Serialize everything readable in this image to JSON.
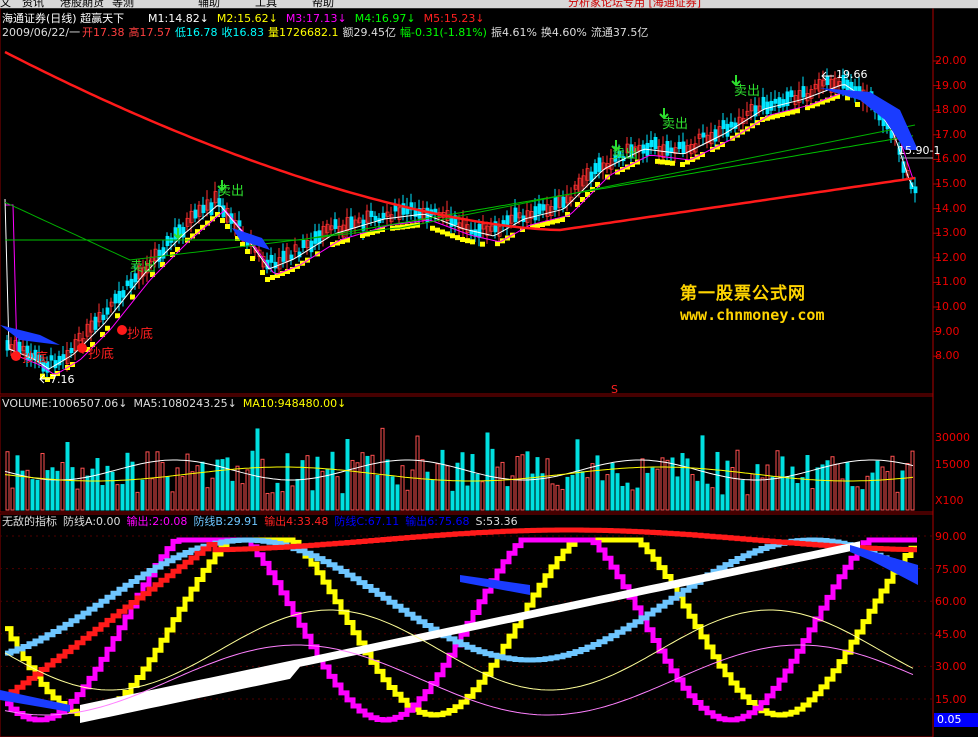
{
  "menu": {
    "items": [
      "文",
      "资讯",
      "港股期货",
      "等测",
      "辅助",
      "工具",
      "帮助"
    ],
    "banner": "分析家论坛专用 [海通证券]"
  },
  "header": {
    "title": "海通证券(日线) 超赢天下",
    "ma": [
      {
        "label": "M1:14.82",
        "color": "#ffffff"
      },
      {
        "label": "M2:15.62",
        "color": "#ffff00"
      },
      {
        "label": "M3:17.13",
        "color": "#ff00ff"
      },
      {
        "label": "M4:16.97",
        "color": "#00ff00"
      },
      {
        "label": "M5:15.23",
        "color": "#ff2020"
      }
    ],
    "quote_date": "2009/06/22/一",
    "quote": [
      {
        "label": "开17.38",
        "color": "#ff4040"
      },
      {
        "label": "高17.57",
        "color": "#ff4040"
      },
      {
        "label": "低16.78",
        "color": "#00ffff"
      },
      {
        "label": "收16.83",
        "color": "#00ffff"
      },
      {
        "label": "量1726682.1",
        "color": "#ffff00"
      },
      {
        "label": "额29.45亿",
        "color": "#dddddd"
      },
      {
        "label": "幅-0.31(-1.81%)",
        "color": "#00ff00"
      },
      {
        "label": "振4.61%",
        "color": "#dddddd"
      },
      {
        "label": "换4.60%",
        "color": "#dddddd"
      },
      {
        "label": "流通37.5亿",
        "color": "#dddddd"
      }
    ]
  },
  "price_axis": [
    "20.00",
    "19.00",
    "18.00",
    "17.00",
    "16.00",
    "15.00",
    "14.00",
    "13.00",
    "12.00",
    "11.00",
    "10.00",
    "9.00",
    "8.00"
  ],
  "annotations": {
    "high": "19.66",
    "low": "7.16",
    "cursor": "15.90-1",
    "s_marker": "S"
  },
  "signals": {
    "sell": "卖出",
    "buy": "抄底"
  },
  "watermark": {
    "line1": "第一股票公式网",
    "line2": "www.chnmoney.com"
  },
  "volume": {
    "header": [
      {
        "label": "VOLUME:1006507.06",
        "color": "#dddddd"
      },
      {
        "label": "MA5:1080243.25",
        "color": "#dddddd"
      },
      {
        "label": "MA10:948480.00",
        "color": "#ffff00"
      }
    ],
    "axis": [
      "30000",
      "15000",
      "X100"
    ]
  },
  "indicator": {
    "header": [
      {
        "label": "无敌的指标",
        "color": "#dddddd"
      },
      {
        "label": "防线A:0.00",
        "color": "#dddddd"
      },
      {
        "label": "输出:2:0.08",
        "color": "#ff00ff"
      },
      {
        "label": "防线B:29.91",
        "color": "#6ec6ff"
      },
      {
        "label": "输出4:33.48",
        "color": "#ff2020"
      },
      {
        "label": "防线C:67.11",
        "color": "#0000ff"
      },
      {
        "label": "输出6:75.68",
        "color": "#0000ff"
      },
      {
        "label": "S:53.36",
        "color": "#dddddd"
      }
    ],
    "axis": [
      "90.00",
      "75.00",
      "60.00",
      "45.00",
      "30.00",
      "15.00"
    ],
    "current": "0.05"
  }
}
